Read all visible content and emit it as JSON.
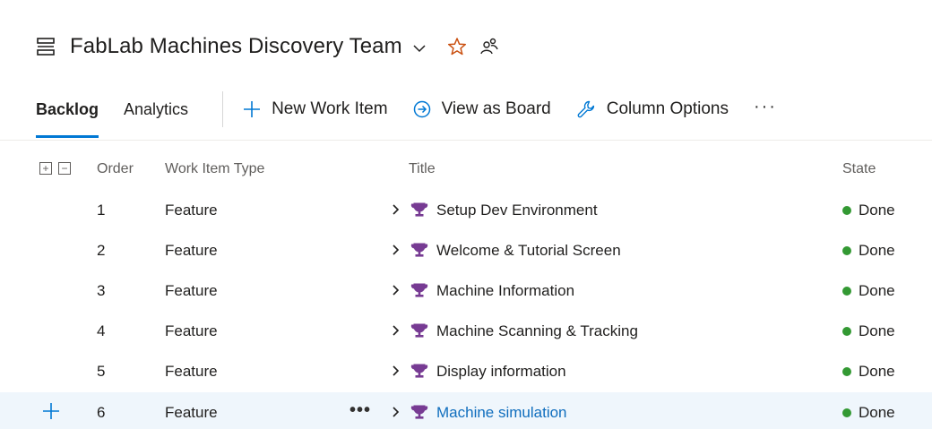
{
  "header": {
    "team_name": "FabLab Machines Discovery Team",
    "favorite_color": "#ca5010"
  },
  "toolbar": {
    "tabs": [
      {
        "label": "Backlog",
        "active": true
      },
      {
        "label": "Analytics",
        "active": false
      }
    ],
    "new_work_item": "New Work Item",
    "view_as_board": "View as Board",
    "column_options": "Column Options",
    "more": "···"
  },
  "grid": {
    "columns": {
      "expand_all": "+",
      "collapse_all": "−",
      "order": "Order",
      "type": "Work Item Type",
      "title": "Title",
      "state": "State"
    },
    "rows": [
      {
        "order": "1",
        "type": "Feature",
        "title": "Setup Dev Environment",
        "state": "Done"
      },
      {
        "order": "2",
        "type": "Feature",
        "title": "Welcome & Tutorial Screen",
        "state": "Done"
      },
      {
        "order": "3",
        "type": "Feature",
        "title": "Machine Information",
        "state": "Done"
      },
      {
        "order": "4",
        "type": "Feature",
        "title": "Machine Scanning & Tracking",
        "state": "Done"
      },
      {
        "order": "5",
        "type": "Feature",
        "title": "Display information",
        "state": "Done"
      },
      {
        "order": "6",
        "type": "Feature",
        "title": "Machine simulation",
        "state": "Done"
      }
    ],
    "row_more": "•••",
    "state_color": "#339933",
    "feature_icon_color": "#773b93",
    "selected_row_bg": "#eff6fc"
  }
}
